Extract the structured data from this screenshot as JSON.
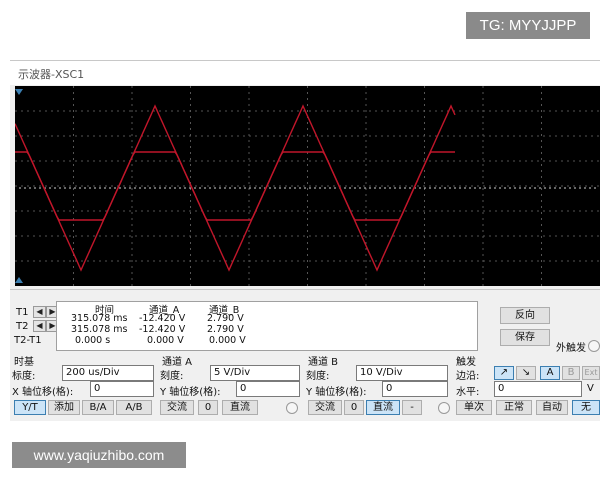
{
  "tg_badge": "TG: MYYJJPP",
  "watermark": "www.yaqiuzhibo.com",
  "window": {
    "title": "示波器-XSC1"
  },
  "readout": {
    "headers": {
      "time": "时间",
      "chA": "通道_A",
      "chB": "通道_B"
    },
    "rows": [
      {
        "label": "T1",
        "time": "315.078 ms",
        "chA": "-12.420 V",
        "chB": "2.790 V"
      },
      {
        "label": "T2",
        "time": "315.078 ms",
        "chA": "-12.420 V",
        "chB": "2.790 V"
      },
      {
        "label": "T2-T1",
        "time": "0.000 s",
        "chA": "0.000 V",
        "chB": "0.000 V"
      }
    ],
    "left_arrow": "◀",
    "right_arrow": "▶"
  },
  "buttons": {
    "reverse": "反向",
    "save": "保存",
    "ext_trigger": "外触发"
  },
  "timebase": {
    "title": "时基",
    "scale_label": "标度:",
    "scale_value": "200 us/Div",
    "xpos_label": "X 轴位移(格):",
    "xpos_value": "0",
    "modes": [
      "Y/T",
      "添加",
      "B/A",
      "A/B"
    ]
  },
  "channel_a": {
    "title": "通道 A",
    "scale_label": "刻度:",
    "scale_value": "5  V/Div",
    "ypos_label": "Y 轴位移(格):",
    "ypos_value": "0",
    "coupling": [
      "交流",
      "0",
      "直流"
    ]
  },
  "channel_b": {
    "title": "通道 B",
    "scale_label": "刻度:",
    "scale_value": "10  V/Div",
    "ypos_label": "Y 轴位移(格):",
    "ypos_value": "0",
    "coupling": [
      "交流",
      "0",
      "直流",
      "-"
    ]
  },
  "trigger": {
    "title": "触发",
    "edge_label": "边沿:",
    "edge_rising": "↗",
    "edge_falling": "↘",
    "source_a": "A",
    "source_b": "B",
    "source_ext": "Ext",
    "level_label": "水平:",
    "level_value": "0",
    "level_unit": "V",
    "modes": [
      "单次",
      "正常",
      "自动",
      "无"
    ]
  },
  "colors": {
    "screen_bg": "#000000",
    "channel_a": "#c0162a",
    "channel_b": "#c0162a",
    "grid": "#5a5a5a"
  }
}
